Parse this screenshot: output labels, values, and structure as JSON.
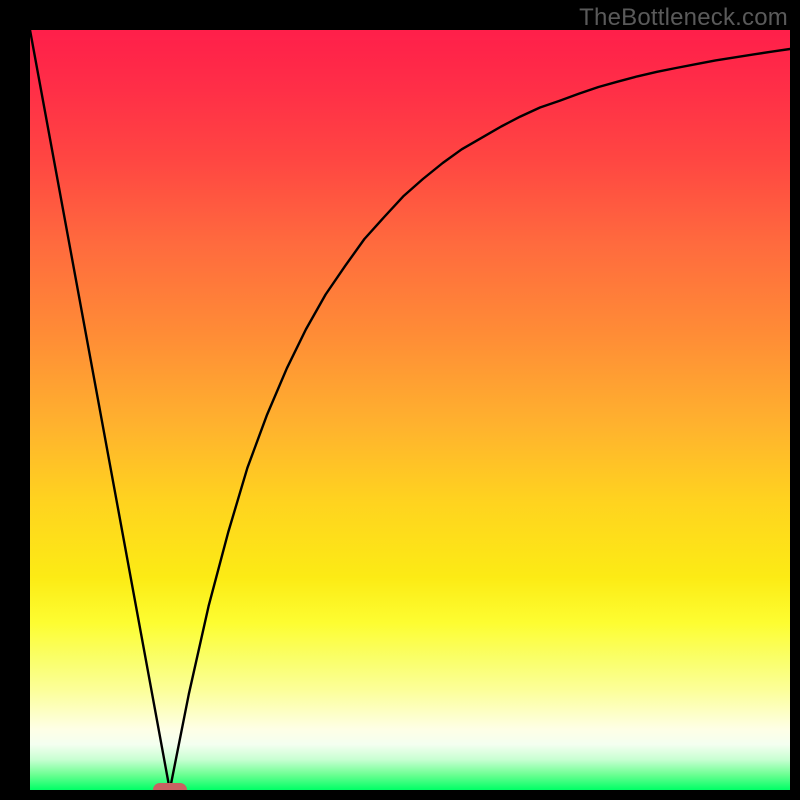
{
  "watermark": "TheBottleneck.com",
  "colors": {
    "frame": "#000000",
    "curve": "#000000",
    "marker": "#c96262",
    "gradient_top": "#ff1f4a",
    "gradient_bottom": "#00ff66"
  },
  "chart_data": {
    "type": "line",
    "title": "",
    "xlabel": "",
    "ylabel": "",
    "xlim": [
      0,
      100
    ],
    "ylim": [
      0,
      100
    ],
    "grid": false,
    "legend": false,
    "series": [
      {
        "name": "left-line",
        "x": [
          0,
          18.4
        ],
        "y": [
          100,
          0
        ]
      },
      {
        "name": "right-curve",
        "x": [
          18.4,
          20.9,
          23.5,
          26.1,
          28.6,
          31.2,
          33.8,
          36.3,
          38.9,
          41.5,
          44.0,
          46.6,
          49.1,
          51.7,
          54.3,
          56.8,
          59.4,
          62.0,
          64.5,
          67.1,
          69.7,
          72.2,
          74.8,
          77.3,
          79.9,
          82.5,
          85.0,
          87.6,
          90.2,
          92.7,
          95.3,
          97.9,
          100.0
        ],
        "y": [
          0,
          12.6,
          24.2,
          34.0,
          42.4,
          49.4,
          55.5,
          60.6,
          65.2,
          69.0,
          72.5,
          75.4,
          78.1,
          80.4,
          82.5,
          84.3,
          85.8,
          87.3,
          88.6,
          89.8,
          90.7,
          91.6,
          92.5,
          93.2,
          93.9,
          94.5,
          95.0,
          95.5,
          96.0,
          96.4,
          96.8,
          97.2,
          97.5
        ]
      }
    ],
    "marker": {
      "x": 18.4,
      "y": 0
    },
    "gradient": {
      "stops": [
        {
          "pos": 0,
          "color": "#ff1f4a"
        },
        {
          "pos": 0.4,
          "color": "#ff8c36"
        },
        {
          "pos": 0.72,
          "color": "#fceb15"
        },
        {
          "pos": 0.92,
          "color": "#feffe6"
        },
        {
          "pos": 1.0,
          "color": "#00ff66"
        }
      ]
    }
  }
}
